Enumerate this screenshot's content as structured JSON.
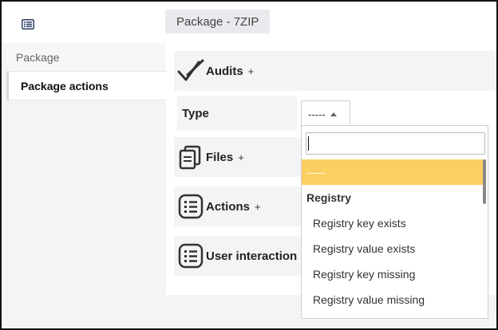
{
  "header": {
    "menu_icon": "list-icon",
    "title": "Package - 7ZIP"
  },
  "sidebar": {
    "items": [
      {
        "label": "Package"
      },
      {
        "label": "Package actions"
      }
    ]
  },
  "sections": {
    "audits": {
      "label": "Audits",
      "plus": "+",
      "icon": "double-check-icon"
    },
    "files": {
      "label": "Files",
      "plus": "+",
      "icon": "copy-files-icon"
    },
    "actions": {
      "label": "Actions",
      "plus": "+",
      "icon": "list-icon"
    },
    "user_interaction": {
      "label": "User interaction",
      "icon": "list-icon"
    }
  },
  "type_field": {
    "label": "Type",
    "selected_value": "-----"
  },
  "dropdown": {
    "search_value": "",
    "items": [
      {
        "kind": "selected",
        "label": "-----"
      },
      {
        "kind": "group",
        "label": "Registry"
      },
      {
        "kind": "option",
        "label": "Registry key exists"
      },
      {
        "kind": "option",
        "label": "Registry value exists"
      },
      {
        "kind": "option",
        "label": "Registry key missing"
      },
      {
        "kind": "option",
        "label": "Registry value missing"
      }
    ]
  },
  "colors": {
    "highlight": "#fccf62",
    "panel": "#f3f4f5",
    "background": "#f3f4f6"
  }
}
